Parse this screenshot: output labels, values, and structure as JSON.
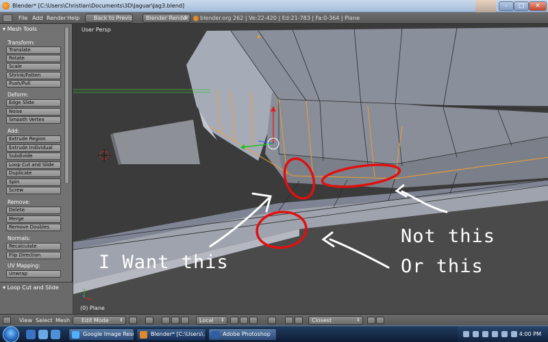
{
  "window": {
    "title": "Blender* [C:\\Users\\Christian\\Documents\\3D\\Jaguar\\Jag3.blend]"
  },
  "top_header": {
    "menus": [
      "File",
      "Add",
      "Render",
      "Help"
    ],
    "back_button": "Back to Previous",
    "render_engine": "Blender Render",
    "info": "blender.org 262 | Ve:22-420 | Ed:21-783 | Fa:0-364 | Plane"
  },
  "tool_panel": {
    "title": "Mesh Tools",
    "sections": {
      "transform": {
        "label": "Transform:",
        "buttons": [
          "Translate",
          "Rotate",
          "Scale",
          "Shrink/Fatten",
          "Push/Pull"
        ]
      },
      "deform": {
        "label": "Deform:",
        "buttons": [
          "Edge Slide",
          "Noise",
          "Smooth Vertex"
        ]
      },
      "add": {
        "label": "Add:",
        "buttons": [
          "Extrude Region",
          "Extrude Individual",
          "Subdivide",
          "Loop Cut and Slide",
          "Duplicate",
          "Spin",
          "Screw"
        ]
      },
      "remove": {
        "label": "Remove:",
        "buttons": [
          "Delete",
          "Merge",
          "Remove Doubles"
        ]
      },
      "normals": {
        "label": "Normals:",
        "buttons": [
          "Recalculate",
          "Flip Direction"
        ]
      },
      "uv": {
        "label": "UV Mapping:",
        "buttons": [
          "Unwrap"
        ]
      }
    },
    "operator_panel_title": "Loop Cut and Slide"
  },
  "viewport": {
    "view_label": "User Persp",
    "object_label": "(0) Plane"
  },
  "annotations": {
    "want": "I Want this",
    "not_this": "Not this",
    "or_this": "Or this"
  },
  "bottom_header": {
    "menus": [
      "View",
      "Select",
      "Mesh"
    ],
    "mode": "Edit Mode",
    "orientation": "Local",
    "snap": "Closest"
  },
  "taskbar": {
    "tasks": [
      "Google Image Resul...",
      "Blender* [C:\\Users\\...",
      "Adobe Photoshop"
    ],
    "clock": "4:00 PM"
  },
  "colors": {
    "annotation_red": "#e01010",
    "selected_edge": "#f0a030"
  }
}
